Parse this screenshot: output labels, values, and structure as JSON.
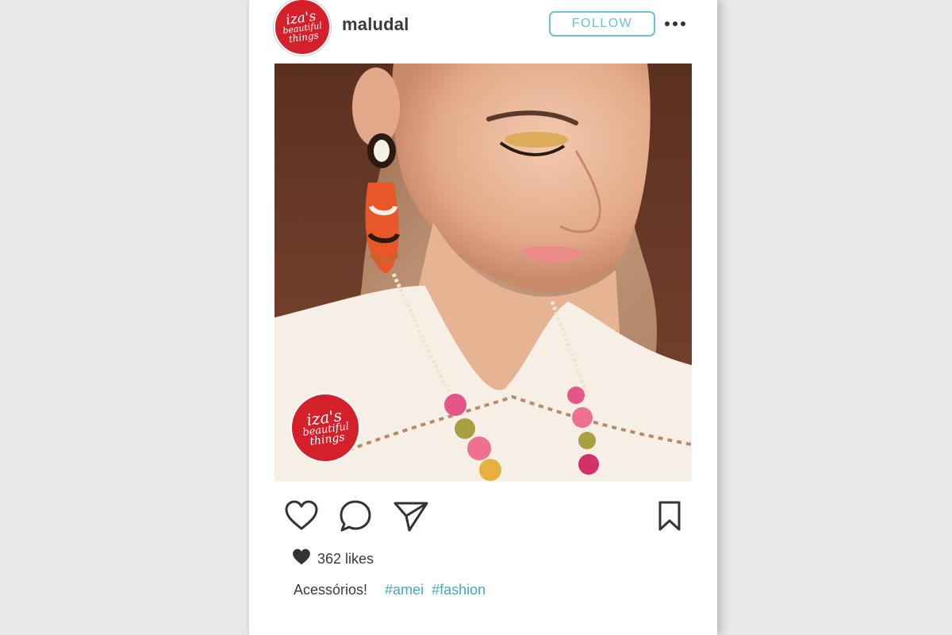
{
  "post": {
    "username": "maludal",
    "follow_label": "FOLLOW",
    "likes": "362 likes",
    "caption_text": "Acessórios!",
    "hashtags": [
      "#amei",
      "#fashion"
    ]
  },
  "brand_logo": {
    "line1": "iza's",
    "line2": "beautiful",
    "line3": "things",
    "color": "#d4202a"
  },
  "icons": {
    "more": "more-dots-icon",
    "like": "heart-outline-icon",
    "comment": "comment-bubble-icon",
    "share": "paper-plane-icon",
    "save": "bookmark-icon",
    "likes_heart": "heart-filled-icon"
  },
  "colors": {
    "accent": "#6ebfd6",
    "hashtag": "#4aa7c4",
    "text": "#3a3a3a",
    "background": "#e8e8e8"
  }
}
